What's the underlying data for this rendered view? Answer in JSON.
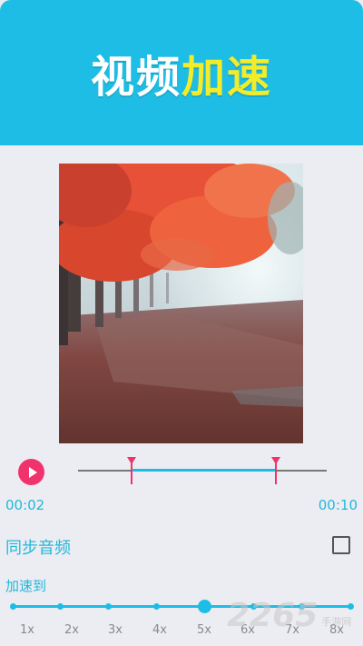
{
  "banner": {
    "title_part1": "视频",
    "title_part2": "加速",
    "bg_color": "#1ebde5",
    "highlight_color": "#f2ec2a"
  },
  "player": {
    "play_icon": "play-icon",
    "time_start": "00:02",
    "time_end": "00:10"
  },
  "sync_audio": {
    "label": "同步音频",
    "checked": false
  },
  "speed": {
    "label": "加速到",
    "ticks": [
      "1x",
      "2x",
      "3x",
      "4x",
      "5x",
      "6x",
      "7x",
      "8x"
    ],
    "selected": "5x"
  },
  "watermark": {
    "number": "2265",
    "text": "手游网"
  }
}
